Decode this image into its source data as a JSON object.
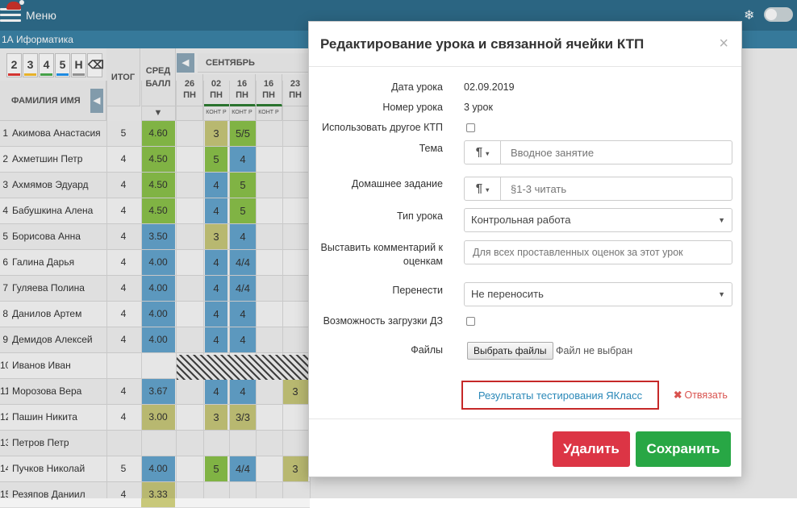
{
  "topbar": {
    "menu_label": "Меню",
    "snow_icon": "❄"
  },
  "subbar": {
    "class_label": "1А Иформатика"
  },
  "journal": {
    "mark_buttons": [
      {
        "label": "2",
        "color": "#e53935"
      },
      {
        "label": "3",
        "color": "#fbc02d"
      },
      {
        "label": "4",
        "color": "#4caf50"
      },
      {
        "label": "5",
        "color": "#2196f3"
      },
      {
        "label": "Н",
        "color": "#9e9e9e"
      }
    ],
    "headers": {
      "name": "ФАМИЛИЯ ИМЯ",
      "itog": "ИТОГ",
      "avg_line1": "СРЕД",
      "avg_line2": "БАЛЛ",
      "month": "СЕНТЯБРЬ"
    },
    "dates": [
      {
        "day": "26",
        "dow": "ПН",
        "tag": ""
      },
      {
        "day": "02",
        "dow": "ПН",
        "tag": "КОНТ Р"
      },
      {
        "day": "16",
        "dow": "ПН",
        "tag": "КОНТ Р"
      },
      {
        "day": "16",
        "dow": "ПН",
        "tag": "КОНТ Р"
      },
      {
        "day": "23",
        "dow": "ПН",
        "tag": ""
      }
    ],
    "students": [
      {
        "num": "1",
        "name": "Акимова Анастасия",
        "itog": "5",
        "avg": "4.60",
        "avg_color": "#8bc34a",
        "g1": "3",
        "g1c": "#c8c87a",
        "g2": "5/5",
        "g2c": "#8bc34a",
        "g3": "",
        "g3c": ""
      },
      {
        "num": "2",
        "name": "Ахметшин Петр",
        "itog": "4",
        "avg": "4.50",
        "avg_color": "#8bc34a",
        "g1": "5",
        "g1c": "#8bc34a",
        "g2": "4",
        "g2c": "#64a5cf",
        "g3": "",
        "g3c": ""
      },
      {
        "num": "3",
        "name": "Ахмямов Эдуард",
        "itog": "4",
        "avg": "4.50",
        "avg_color": "#8bc34a",
        "g1": "4",
        "g1c": "#64a5cf",
        "g2": "5",
        "g2c": "#8bc34a",
        "g3": "",
        "g3c": ""
      },
      {
        "num": "4",
        "name": "Бабушкина Алена",
        "itog": "4",
        "avg": "4.50",
        "avg_color": "#8bc34a",
        "g1": "4",
        "g1c": "#64a5cf",
        "g2": "5",
        "g2c": "#8bc34a",
        "g3": "",
        "g3c": ""
      },
      {
        "num": "5",
        "name": "Борисова Анна",
        "itog": "4",
        "avg": "3.50",
        "avg_color": "#64a5cf",
        "g1": "3",
        "g1c": "#c8c87a",
        "g2": "4",
        "g2c": "#64a5cf",
        "g3": "",
        "g3c": ""
      },
      {
        "num": "6",
        "name": "Галина Дарья",
        "itog": "4",
        "avg": "4.00",
        "avg_color": "#64a5cf",
        "g1": "4",
        "g1c": "#64a5cf",
        "g2": "4/4",
        "g2c": "#64a5cf",
        "g3": "",
        "g3c": ""
      },
      {
        "num": "7",
        "name": "Гуляева Полина",
        "itog": "4",
        "avg": "4.00",
        "avg_color": "#64a5cf",
        "g1": "4",
        "g1c": "#64a5cf",
        "g2": "4/4",
        "g2c": "#64a5cf",
        "g3": "",
        "g3c": ""
      },
      {
        "num": "8",
        "name": "Данилов Артем",
        "itog": "4",
        "avg": "4.00",
        "avg_color": "#64a5cf",
        "g1": "4",
        "g1c": "#64a5cf",
        "g2": "4",
        "g2c": "#64a5cf",
        "g3": "",
        "g3c": ""
      },
      {
        "num": "9",
        "name": "Демидов Алексей",
        "itog": "4",
        "avg": "4.00",
        "avg_color": "#64a5cf",
        "g1": "4",
        "g1c": "#64a5cf",
        "g2": "4",
        "g2c": "#64a5cf",
        "g3": "",
        "g3c": ""
      },
      {
        "num": "10",
        "name": "Иванов Иван",
        "itog": "",
        "avg": "",
        "avg_color": "",
        "g1": "",
        "g1c": "",
        "g2": "",
        "g2c": "",
        "g3": "",
        "g3c": ""
      },
      {
        "num": "11",
        "name": "Морозова Вера",
        "itog": "4",
        "avg": "3.67",
        "avg_color": "#64a5cf",
        "g1": "4",
        "g1c": "#64a5cf",
        "g2": "4",
        "g2c": "#64a5cf",
        "g3": "3",
        "g3c": "#c8c87a"
      },
      {
        "num": "12",
        "name": "Пашин Никита",
        "itog": "4",
        "avg": "3.00",
        "avg_color": "#c8c87a",
        "g1": "3",
        "g1c": "#c8c87a",
        "g2": "3/3",
        "g2c": "#c8c87a",
        "g3": "",
        "g3c": ""
      },
      {
        "num": "13",
        "name": "Петров Петр",
        "itog": "",
        "avg": "",
        "avg_color": "",
        "g1": "",
        "g1c": "",
        "g2": "",
        "g2c": "",
        "g3": "",
        "g3c": ""
      },
      {
        "num": "14",
        "name": "Пучков Николай",
        "itog": "5",
        "avg": "4.00",
        "avg_color": "#64a5cf",
        "g1": "5",
        "g1c": "#8bc34a",
        "g2": "4/4",
        "g2c": "#64a5cf",
        "g3": "3",
        "g3c": "#c8c87a"
      },
      {
        "num": "15",
        "name": "Резяпов Даниил",
        "itog": "4",
        "avg": "3.33",
        "avg_color": "#c8c87a",
        "g1": "",
        "g1c": "",
        "g2": "",
        "g2c": "",
        "g3": "",
        "g3c": ""
      }
    ]
  },
  "modal": {
    "title": "Редактирование урока и связанной ячейки КТП",
    "close_symbol": "×",
    "fields": {
      "date_label": "Дата урока",
      "date_value": "02.09.2019",
      "number_label": "Номер урока",
      "number_value": "3 урок",
      "other_ktp_label": "Использовать другое КТП",
      "topic_label": "Тема",
      "topic_placeholder": "Вводное занятие",
      "homework_label": "Домашнее задание",
      "homework_placeholder": "§1-3 читать",
      "type_label": "Тип урока",
      "type_value": "Контрольная работа",
      "comment_label_line1": "Выставить комментарий к",
      "comment_label_line2": "оценкам",
      "comment_placeholder": "Для всех проставленных оценок за этот урок",
      "move_label": "Перенести",
      "move_value": "Не переносить",
      "upload_label": "Возможность загрузки ДЗ",
      "files_label": "Файлы",
      "files_button": "Выбрать файлы",
      "files_status": "Файл не выбран",
      "paragraph_symbol": "¶",
      "caret_symbol": "▾"
    },
    "yaklass_link": "Результаты тестирования ЯКласс",
    "unlink_label": "Отвязать",
    "unlink_icon": "✖",
    "delete_button": "Удалить",
    "save_button": "Сохранить",
    "colors": {
      "delete": "#dc3545",
      "save": "#28a745",
      "link_border": "#c62828",
      "link_text": "#2a88b8"
    }
  }
}
